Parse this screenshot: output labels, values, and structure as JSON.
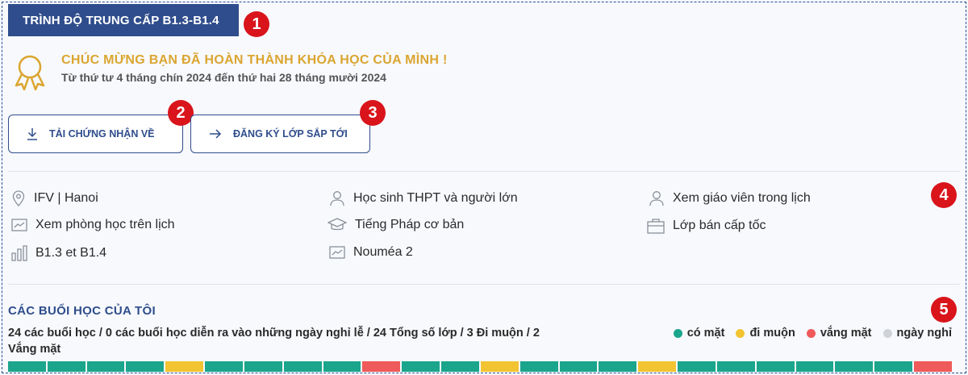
{
  "level_tag": "TRÌNH ĐỘ TRUNG CẤP B1.3-B1.4",
  "badges": [
    "1",
    "2",
    "3",
    "4",
    "5"
  ],
  "congrats": {
    "title": "CHÚC MỪNG BẠN ĐÃ HOÀN THÀNH KHÓA HỌC CỦA MÌNH !",
    "dates": "Từ thứ tư 4 tháng chín 2024 đến thứ hai 28 tháng mười 2024",
    "icon": "medal-icon"
  },
  "buttons": {
    "download_cert": "TẢI CHỨNG NHẬN VỀ",
    "register_next": "ĐĂNG KÝ LỚP SẮP TỚI"
  },
  "info": {
    "location": "IFV | Hanoi",
    "audience": "Học sinh THPT và người lớn",
    "teacher": "Xem giáo viên trong lịch",
    "room": "Xem phòng học trên lịch",
    "course_type": "Tiếng Pháp cơ bản",
    "class_format": "Lớp bán cấp tốc",
    "levels": "B1.3 et B1.4",
    "classroom": "Nouméa 2"
  },
  "sessions": {
    "title": "CÁC BUỔI HỌC CỦA TÔI",
    "summary": "24 các buổi học / 0 các buổi học diễn ra vào những ngày nghỉ lễ / 24 Tổng số lớp / 3 Đi muộn / 2 Vắng mặt",
    "legend": [
      {
        "label": "có mặt",
        "color": "#1aa58c"
      },
      {
        "label": "đi muộn",
        "color": "#f2c432"
      },
      {
        "label": "vắng mặt",
        "color": "#ef5a5a"
      },
      {
        "label": "ngày nghỉ",
        "color": "#cfd3d8"
      }
    ],
    "bar": [
      "present",
      "present",
      "present",
      "present",
      "late",
      "present",
      "present",
      "present",
      "present",
      "absent",
      "present",
      "present",
      "late",
      "present",
      "present",
      "present",
      "late",
      "present",
      "present",
      "present",
      "present",
      "present",
      "present",
      "absent"
    ],
    "status_colors": {
      "present": "#1aa58c",
      "late": "#f2c432",
      "absent": "#ef5a5a",
      "holiday": "#cfd3d8"
    }
  }
}
